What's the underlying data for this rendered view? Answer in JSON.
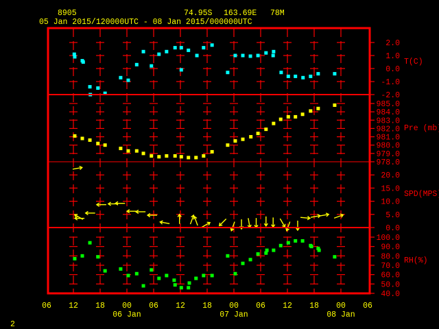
{
  "header": {
    "station_id": "8905",
    "latitude": "74.95S",
    "longitude": "163.69E",
    "elevation": "78M",
    "time_range": "05 Jan 2015/120000UTC - 08 Jan 2015/000000UTC"
  },
  "page_number": "2",
  "colors": {
    "axis": "#ff0000",
    "text": "#ffff00",
    "temperature": "#00ffff",
    "pressure": "#ffff00",
    "wind": "#ffff00",
    "rh": "#00ff00",
    "background": "#000000"
  },
  "chart_data": [
    {
      "type": "scatter",
      "name": "temperature",
      "ylabel": "T(C)",
      "ylim": [
        -2.0,
        2.0
      ],
      "yticks": [
        "2.0",
        "1.0",
        "0.0",
        "-1.0",
        "-2.0"
      ],
      "x_units": "hours since 05 Jan 2015 12UTC",
      "points": [
        [
          0.2,
          1.1
        ],
        [
          0.3,
          0.9
        ],
        [
          2.0,
          0.6
        ],
        [
          2.2,
          0.5
        ],
        [
          3.7,
          -1.4
        ],
        [
          3.8,
          -2.0
        ],
        [
          5.5,
          -1.5
        ],
        [
          7.1,
          -1.9
        ],
        [
          10.6,
          -0.7
        ],
        [
          12.3,
          -0.9
        ],
        [
          14.2,
          0.3
        ],
        [
          15.7,
          1.3
        ],
        [
          17.5,
          0.2
        ],
        [
          19.2,
          1.1
        ],
        [
          20.9,
          1.3
        ],
        [
          22.8,
          1.6
        ],
        [
          24.2,
          1.6
        ],
        [
          24.2,
          -0.1
        ],
        [
          25.8,
          1.4
        ],
        [
          27.7,
          1.0
        ],
        [
          29.2,
          1.6
        ],
        [
          31.1,
          1.8
        ],
        [
          34.6,
          -0.3
        ],
        [
          36.3,
          1.0
        ],
        [
          38.0,
          1.0
        ],
        [
          39.7,
          0.95
        ],
        [
          41.4,
          1.0
        ],
        [
          43.2,
          1.2
        ],
        [
          44.8,
          1.0
        ],
        [
          44.9,
          1.3
        ],
        [
          46.6,
          -0.3
        ],
        [
          48.2,
          -0.6
        ],
        [
          49.8,
          -0.6
        ],
        [
          51.5,
          -0.7
        ],
        [
          53.2,
          -0.6
        ],
        [
          54.9,
          -0.4
        ],
        [
          58.6,
          -0.4
        ]
      ]
    },
    {
      "type": "scatter",
      "name": "pressure",
      "ylabel": "Pre (mb)",
      "ylim": [
        978.0,
        985.0
      ],
      "yticks": [
        "985.0",
        "984.0",
        "983.0",
        "982.0",
        "981.0",
        "980.0",
        "979.0",
        "978.0"
      ],
      "x_units": "hours since 05 Jan 2015 12UTC",
      "points": [
        [
          0.3,
          981.1
        ],
        [
          2.0,
          980.8
        ],
        [
          3.7,
          980.6
        ],
        [
          5.5,
          980.2
        ],
        [
          7.1,
          980.0
        ],
        [
          10.6,
          979.6
        ],
        [
          12.3,
          979.3
        ],
        [
          14.2,
          979.3
        ],
        [
          15.7,
          979.0
        ],
        [
          17.5,
          978.7
        ],
        [
          19.2,
          978.6
        ],
        [
          20.9,
          978.7
        ],
        [
          22.8,
          978.7
        ],
        [
          24.2,
          978.6
        ],
        [
          25.8,
          978.5
        ],
        [
          27.5,
          978.5
        ],
        [
          29.2,
          978.7
        ],
        [
          31.1,
          979.2
        ],
        [
          34.6,
          980.0
        ],
        [
          36.3,
          980.5
        ],
        [
          38.0,
          980.7
        ],
        [
          39.8,
          981.0
        ],
        [
          41.4,
          981.4
        ],
        [
          43.2,
          981.9
        ],
        [
          44.9,
          982.6
        ],
        [
          46.5,
          983.1
        ],
        [
          48.2,
          983.4
        ],
        [
          49.8,
          983.4
        ],
        [
          51.4,
          983.7
        ],
        [
          53.2,
          984.1
        ],
        [
          54.9,
          984.4
        ],
        [
          58.6,
          984.8
        ]
      ]
    },
    {
      "type": "vector",
      "name": "wind",
      "ylabel": "SPD(MPS)",
      "ylim": [
        0.0,
        25.0
      ],
      "yticks": [
        "20.0",
        "15.0",
        "10.0",
        "5.0",
        "0.0"
      ],
      "x_units": "hours since 05 Jan 2015 12UTC",
      "fields": [
        "hour",
        "speed_mps",
        "arrow_heading_deg"
      ],
      "points": [
        [
          0.9,
          22.5,
          80
        ],
        [
          1.2,
          4.0,
          300
        ],
        [
          1.4,
          3.5,
          270
        ],
        [
          3.8,
          5.5,
          270
        ],
        [
          6.3,
          8.7,
          270
        ],
        [
          8.9,
          9.0,
          270
        ],
        [
          10.5,
          9.2,
          270
        ],
        [
          13.1,
          6.2,
          270
        ],
        [
          15.1,
          6.0,
          270
        ],
        [
          17.7,
          4.7,
          270
        ],
        [
          20.5,
          1.8,
          280
        ],
        [
          23.8,
          3.2,
          0
        ],
        [
          26.6,
          3.0,
          20
        ],
        [
          27.5,
          2.5,
          340
        ],
        [
          29.7,
          1.0,
          60
        ],
        [
          33.5,
          2.0,
          225
        ],
        [
          35.8,
          0.5,
          200
        ],
        [
          37.7,
          1.3,
          180
        ],
        [
          39.4,
          1.8,
          170
        ],
        [
          41.0,
          1.8,
          180
        ],
        [
          43.2,
          2.4,
          180
        ],
        [
          44.8,
          2.0,
          180
        ],
        [
          46.9,
          1.8,
          150
        ],
        [
          48.2,
          0.5,
          200
        ],
        [
          50.3,
          0.8,
          180
        ],
        [
          52.0,
          3.7,
          95
        ],
        [
          54.3,
          4.2,
          80
        ],
        [
          56.2,
          4.7,
          80
        ],
        [
          59.5,
          4.2,
          70
        ]
      ]
    },
    {
      "type": "scatter",
      "name": "relative_humidity",
      "ylabel": "RH(%)",
      "ylim": [
        40.0,
        100.0
      ],
      "yticks": [
        "100.0",
        "90.0",
        "80.0",
        "70.0",
        "60.0",
        "50.0",
        "40.0"
      ],
      "x_units": "hours since 05 Jan 2015 12UTC",
      "points": [
        [
          0.3,
          77
        ],
        [
          2.0,
          80
        ],
        [
          3.7,
          94
        ],
        [
          5.5,
          79
        ],
        [
          7.1,
          64
        ],
        [
          10.6,
          66
        ],
        [
          12.3,
          59
        ],
        [
          14.2,
          61
        ],
        [
          15.7,
          48
        ],
        [
          17.5,
          65
        ],
        [
          19.2,
          56
        ],
        [
          20.9,
          59
        ],
        [
          22.6,
          54
        ],
        [
          22.8,
          49
        ],
        [
          24.2,
          46
        ],
        [
          25.8,
          46
        ],
        [
          26.0,
          51
        ],
        [
          27.5,
          56
        ],
        [
          29.2,
          59
        ],
        [
          31.1,
          59
        ],
        [
          34.6,
          80
        ],
        [
          36.3,
          61
        ],
        [
          38.0,
          72
        ],
        [
          39.7,
          76
        ],
        [
          41.4,
          82
        ],
        [
          43.2,
          83
        ],
        [
          43.4,
          86
        ],
        [
          44.9,
          86
        ],
        [
          46.5,
          91
        ],
        [
          48.2,
          94
        ],
        [
          49.8,
          96
        ],
        [
          51.4,
          96
        ],
        [
          53.2,
          91
        ],
        [
          53.4,
          90
        ],
        [
          54.9,
          88
        ],
        [
          55.1,
          86
        ],
        [
          58.6,
          79
        ]
      ]
    }
  ],
  "x_axis": {
    "xlim_hours": [
      -6,
      66
    ],
    "tick_labels": [
      "06",
      "12",
      "18",
      "00",
      "06",
      "12",
      "18",
      "00",
      "06",
      "12",
      "18",
      "00",
      "06"
    ],
    "day_labels": [
      {
        "hour": 12,
        "label": "06 Jan"
      },
      {
        "hour": 36,
        "label": "07 Jan"
      },
      {
        "hour": 60,
        "label": "08 Jan"
      }
    ]
  }
}
